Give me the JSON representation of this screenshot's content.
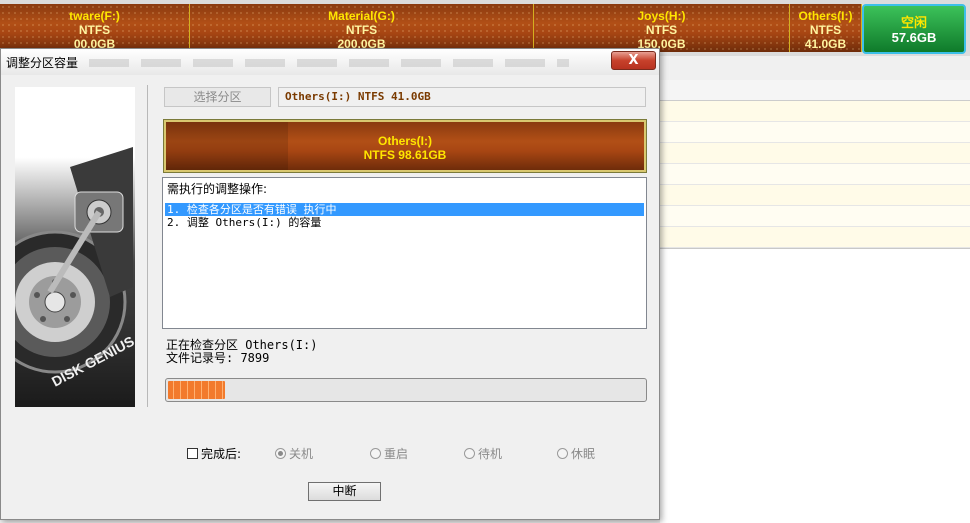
{
  "disk_bar": {
    "partitions": [
      {
        "name": "tware(F:)",
        "fs": "NTFS",
        "size": "00.0GB"
      },
      {
        "name": "Material(G:)",
        "fs": "NTFS",
        "size": "200.0GB"
      },
      {
        "name": "Joys(H:)",
        "fs": "NTFS",
        "size": "150.0GB"
      },
      {
        "name": "Others(I:)",
        "fs": "NTFS",
        "size": "41.0GB"
      }
    ],
    "free": {
      "label": "空闲",
      "size": "57.6GB"
    }
  },
  "dialog": {
    "title": "调整分区容量",
    "close_label": "X",
    "art_text": "DISK GENIUS",
    "select_partition_label": "选择分区",
    "selected_partition": "Others(I:) NTFS 41.0GB",
    "preview": {
      "name": "Others(I:)",
      "detail": "NTFS 98.61GB"
    },
    "ops_title": "需执行的调整操作:",
    "ops": [
      "1. 检查各分区是否有错误    执行中",
      "2. 调整 Others(I:) 的容量"
    ],
    "status_line1": "正在检查分区 Others(I:)",
    "status_line2": "文件记录号: 7899",
    "progress": 0.12,
    "after_label": "完成后:",
    "options": {
      "shutdown": "关机",
      "reboot": "重启",
      "standby": "待机",
      "hibernate": "休眠"
    },
    "stop_label": "中断"
  },
  "colors": {
    "partition": "#b14f16",
    "partition_text": "#ffe600",
    "free": "#1f9a3d",
    "selection": "#3399ff",
    "progress": "#f27a2c"
  }
}
